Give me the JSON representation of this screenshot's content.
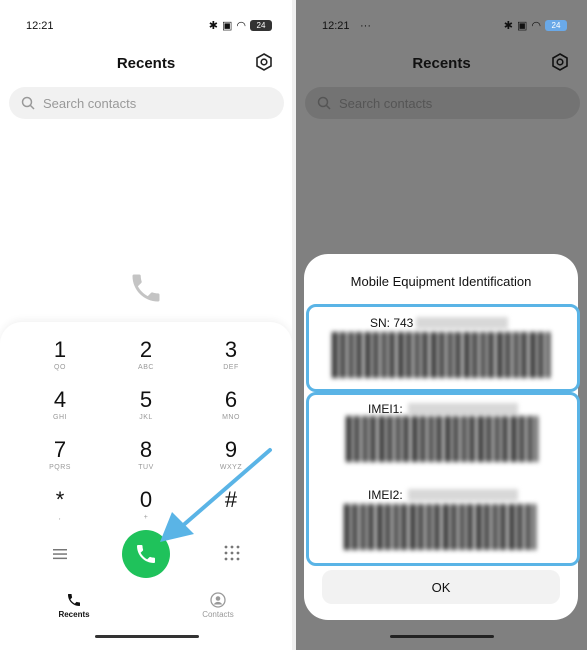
{
  "left": {
    "status": {
      "time": "12:21",
      "battery": "24"
    },
    "title": "Recents",
    "search_placeholder": "Search contacts",
    "keys": [
      {
        "digit": "1",
        "letters": "QO"
      },
      {
        "digit": "2",
        "letters": "ABC"
      },
      {
        "digit": "3",
        "letters": "DEF"
      },
      {
        "digit": "4",
        "letters": "GHI"
      },
      {
        "digit": "5",
        "letters": "JKL"
      },
      {
        "digit": "6",
        "letters": "MNO"
      },
      {
        "digit": "7",
        "letters": "PQRS"
      },
      {
        "digit": "8",
        "letters": "TUV"
      },
      {
        "digit": "9",
        "letters": "WXYZ"
      },
      {
        "digit": "*",
        "letters": ","
      },
      {
        "digit": "0",
        "letters": "+"
      },
      {
        "digit": "#",
        "letters": ""
      }
    ],
    "tabs": {
      "recents": "Recents",
      "contacts": "Contacts"
    }
  },
  "right": {
    "status": {
      "time": "12:21",
      "extra": "···",
      "battery": "24"
    },
    "title": "Recents",
    "search_placeholder": "Search contacts",
    "dialog": {
      "title": "Mobile Equipment Identification",
      "sn_label": "SN: 743",
      "imei1_label": "IMEI1:",
      "imei2_label": "IMEI2:",
      "ok_label": "OK"
    }
  },
  "colors": {
    "call": "#1fc25b",
    "highlight": "#5ab4e6",
    "arrow": "#5ab4e6"
  }
}
